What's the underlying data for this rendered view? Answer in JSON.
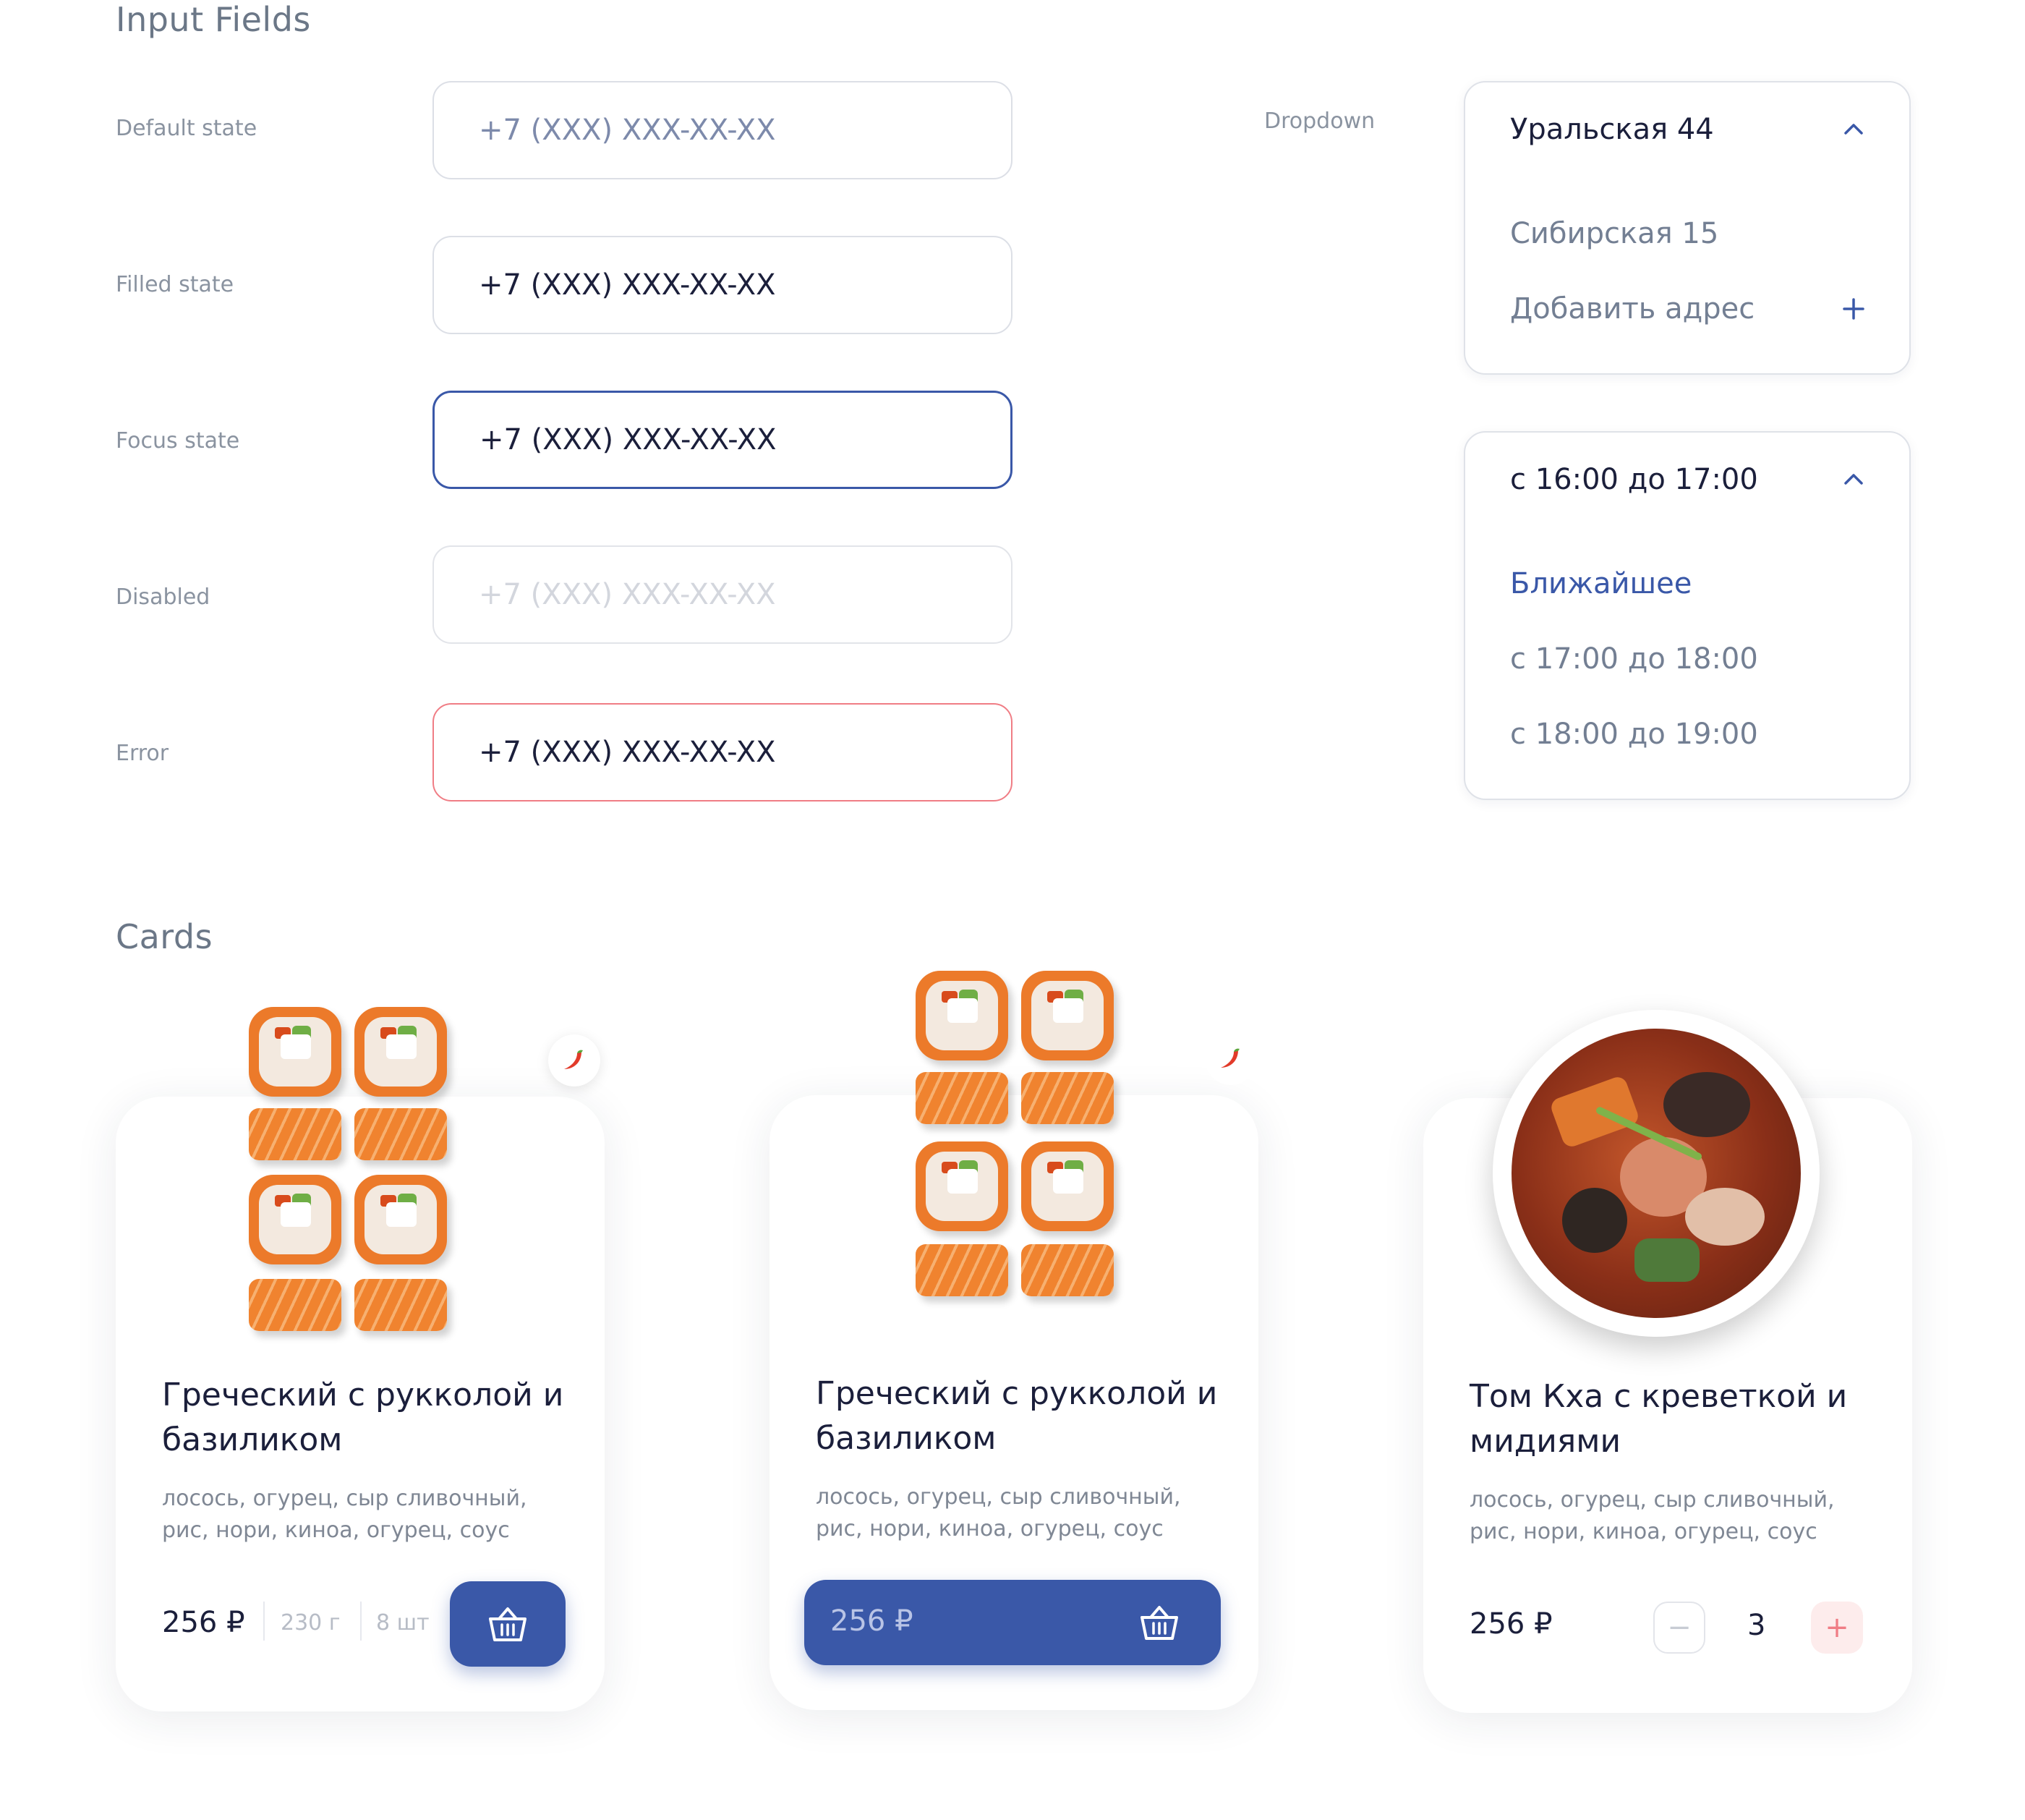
{
  "input_fields": {
    "title": "Input Fields",
    "rows": [
      {
        "label": "Default state",
        "value": "+7 (XXX) XXX-XX-XX"
      },
      {
        "label": "Filled state",
        "value": "+7 (XXX) XXX-XX-XX"
      },
      {
        "label": "Focus state",
        "value": "+7 (XXX) XXX-XX-XX"
      },
      {
        "label": "Disabled",
        "value": "+7 (XXX) XXX-XX-XX"
      },
      {
        "label": "Error",
        "value": "+7 (XXX) XXX-XX-XX"
      }
    ]
  },
  "dropdown": {
    "label": "Dropdown",
    "address": {
      "selected": "Уральская 44",
      "options": [
        "Сибирская 15"
      ],
      "add_label": "Добавить адрес",
      "chevron_icon": "chevron-up-icon",
      "add_icon": "plus-icon"
    },
    "time": {
      "selected": "с 16:00 до 17:00",
      "options": [
        "Ближайшее",
        "с 17:00 до 18:00",
        "с 18:00 до 19:00"
      ],
      "chevron_icon": "chevron-up-icon"
    }
  },
  "cards": {
    "title": "Cards",
    "items": [
      {
        "title": "Греческий с рукколой и базиликом",
        "description": "лосось, огурец, сыр сливочный, рис, нори, киноа, огурец, соус",
        "price": "256 ₽",
        "weight": "230 г",
        "count": "8 шт",
        "badge_icon": "chili-pepper-icon",
        "cart_icon": "basket-icon"
      },
      {
        "title": "Греческий с рукколой и базиликом",
        "description": "лосось, огурец, сыр сливочный, рис, нори, киноа, огурец, соус",
        "price": "256 ₽",
        "badge_icon": "chili-pepper-icon",
        "cart_icon": "basket-icon"
      },
      {
        "title": "Том Кха с креветкой и мидиями",
        "description": "лосось, огурец, сыр сливочный, рис, нори, киноа, огурец, соус",
        "price": "256 ₽",
        "quantity": "3",
        "minus_label": "−",
        "plus_label": "+"
      }
    ]
  },
  "colors": {
    "accent": "#3a58a8",
    "error": "#f07d85",
    "label": "#8a93a0",
    "text": "#1b1f3b"
  }
}
